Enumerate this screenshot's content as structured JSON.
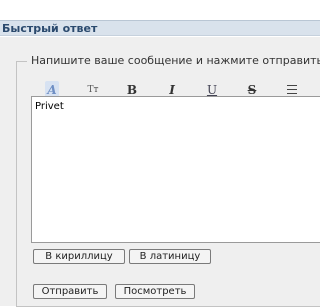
{
  "header": {
    "title": "Быстрый ответ"
  },
  "form": {
    "legend": "Напишите ваше сообщение и нажмите отправить",
    "message_value": "Privet"
  },
  "toolbar": {
    "buttons": [
      {
        "name": "font-color",
        "label": "A"
      },
      {
        "name": "font-size",
        "label": "Tт"
      },
      {
        "name": "bold",
        "label": "B"
      },
      {
        "name": "italic",
        "label": "I"
      },
      {
        "name": "underline",
        "label": "U"
      },
      {
        "name": "strikethrough",
        "label": "S"
      },
      {
        "name": "align",
        "icon": "align-lines-icon"
      }
    ]
  },
  "buttons": {
    "cyrillic": "В кириллицу",
    "latin": "В латиницу",
    "send": "Отправить",
    "preview": "Посмотреть"
  }
}
